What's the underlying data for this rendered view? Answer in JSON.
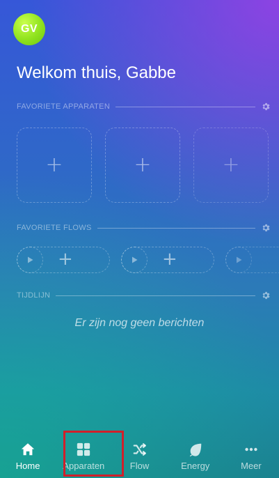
{
  "user": {
    "initials": "GV"
  },
  "greeting": "Welkom thuis, Gabbe",
  "sections": {
    "favorite_devices": {
      "title": "FAVORIETE APPARATEN",
      "icon": "gear-icon"
    },
    "favorite_flows": {
      "title": "FAVORIETE FLOWS",
      "icon": "gear-icon"
    },
    "timeline": {
      "title": "TIJDLIJN",
      "icon": "gear-icon",
      "empty_message": "Er zijn nog geen berichten"
    }
  },
  "placeholders": {
    "add_symbol": "+"
  },
  "bottom_nav": {
    "items": [
      {
        "label": "Home",
        "icon": "home-icon",
        "active": true
      },
      {
        "label": "Apparaten",
        "icon": "grid-icon",
        "active": false
      },
      {
        "label": "Flow",
        "icon": "shuffle-icon",
        "active": false
      },
      {
        "label": "Energy",
        "icon": "leaf-icon",
        "active": false
      },
      {
        "label": "Meer",
        "icon": "more-icon",
        "active": false
      }
    ]
  },
  "colors": {
    "avatar": "#8fe21e",
    "highlight": "#d11f2a"
  }
}
